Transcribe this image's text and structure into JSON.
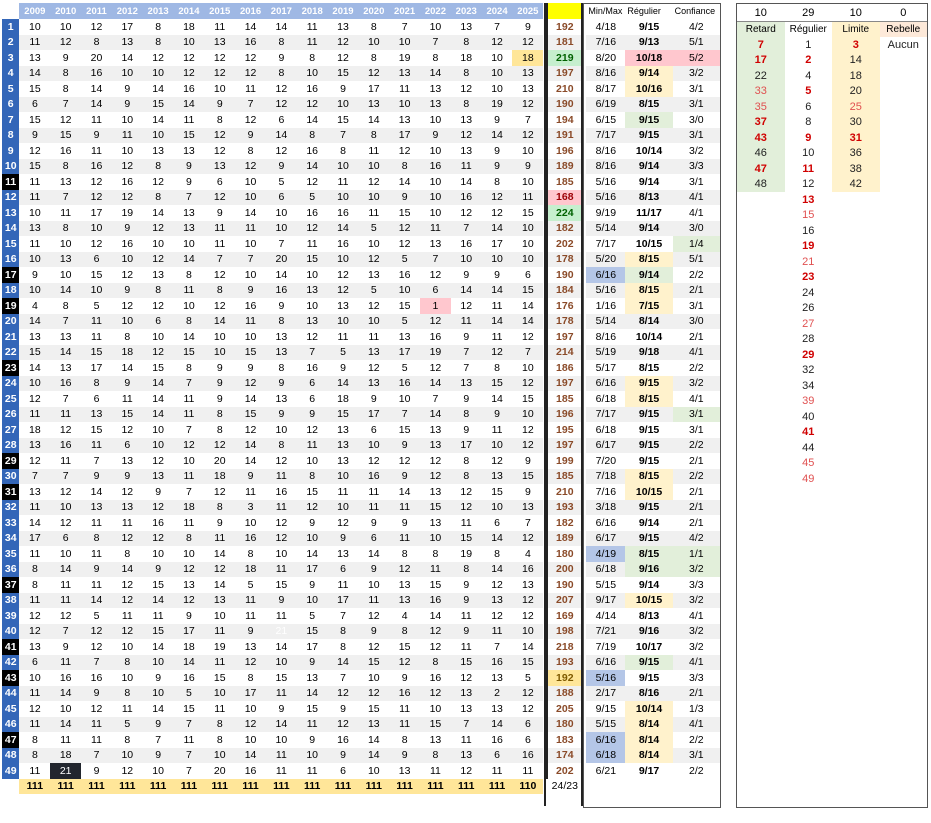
{
  "years": [
    "2009",
    "2010",
    "2011",
    "2012",
    "2013",
    "2014",
    "2015",
    "2016",
    "2017",
    "2018",
    "2019",
    "2020",
    "2021",
    "2022",
    "2023",
    "2024",
    "2025"
  ],
  "headers": {
    "minmax": "Min/Max",
    "regulier": "Régulier",
    "confiance": "Confiance"
  },
  "rows": [
    {
      "n": 1,
      "v": [
        10,
        10,
        12,
        17,
        8,
        18,
        11,
        14,
        14,
        11,
        13,
        8,
        7,
        10,
        13,
        7,
        9
      ],
      "total": 192,
      "minmax": "4/18",
      "reg": "9/15",
      "conf": "4/2"
    },
    {
      "n": 2,
      "v": [
        11,
        12,
        8,
        13,
        8,
        10,
        13,
        16,
        8,
        11,
        12,
        10,
        10,
        7,
        8,
        12,
        12
      ],
      "total": 181,
      "minmax": "7/16",
      "reg": "9/13",
      "conf": "5/1"
    },
    {
      "n": 3,
      "v": [
        13,
        9,
        20,
        14,
        12,
        12,
        12,
        12,
        9,
        8,
        12,
        8,
        19,
        8,
        18,
        10,
        18
      ],
      "total": 219,
      "minmax": "8/20",
      "reg": "10/18",
      "conf": "5/2"
    },
    {
      "n": 4,
      "v": [
        14,
        8,
        16,
        10,
        10,
        12,
        12,
        12,
        8,
        10,
        15,
        12,
        13,
        14,
        8,
        10,
        13
      ],
      "total": 197,
      "minmax": "8/16",
      "reg": "9/14",
      "conf": "3/2"
    },
    {
      "n": 5,
      "v": [
        15,
        8,
        14,
        9,
        14,
        16,
        10,
        11,
        12,
        16,
        9,
        17,
        11,
        13,
        12,
        10,
        13
      ],
      "total": 210,
      "minmax": "8/17",
      "reg": "10/16",
      "conf": "3/1"
    },
    {
      "n": 6,
      "v": [
        6,
        7,
        14,
        9,
        15,
        14,
        9,
        7,
        12,
        12,
        10,
        13,
        10,
        13,
        8,
        19,
        12
      ],
      "total": 190,
      "minmax": "6/19",
      "reg": "8/15",
      "conf": "3/1"
    },
    {
      "n": 7,
      "v": [
        15,
        12,
        11,
        10,
        14,
        11,
        8,
        12,
        6,
        14,
        15,
        14,
        13,
        10,
        13,
        9,
        7
      ],
      "total": 194,
      "minmax": "6/15",
      "reg": "9/15",
      "conf": "3/0"
    },
    {
      "n": 8,
      "v": [
        9,
        15,
        9,
        11,
        10,
        15,
        12,
        9,
        14,
        8,
        7,
        8,
        17,
        9,
        12,
        14,
        12
      ],
      "total": 191,
      "minmax": "7/17",
      "reg": "9/15",
      "conf": "3/1"
    },
    {
      "n": 9,
      "v": [
        12,
        16,
        11,
        10,
        13,
        13,
        12,
        8,
        12,
        16,
        8,
        11,
        12,
        10,
        13,
        9,
        10
      ],
      "total": 196,
      "minmax": "8/16",
      "reg": "10/14",
      "conf": "3/2"
    },
    {
      "n": 10,
      "v": [
        15,
        8,
        16,
        12,
        8,
        9,
        13,
        12,
        9,
        14,
        10,
        10,
        8,
        16,
        11,
        9,
        9
      ],
      "total": 189,
      "minmax": "8/16",
      "reg": "9/14",
      "conf": "3/3"
    },
    {
      "n": 11,
      "v": [
        11,
        13,
        12,
        16,
        12,
        9,
        6,
        10,
        5,
        12,
        11,
        12,
        14,
        10,
        14,
        8,
        10
      ],
      "total": 185,
      "minmax": "5/16",
      "reg": "9/14",
      "conf": "3/1"
    },
    {
      "n": 12,
      "v": [
        11,
        7,
        12,
        12,
        8,
        7,
        12,
        10,
        6,
        5,
        10,
        10,
        9,
        10,
        16,
        12,
        11
      ],
      "total": 168,
      "minmax": "5/16",
      "reg": "8/13",
      "conf": "4/1"
    },
    {
      "n": 13,
      "v": [
        10,
        11,
        17,
        19,
        14,
        13,
        9,
        14,
        10,
        16,
        16,
        11,
        15,
        10,
        12,
        12,
        15
      ],
      "total": 224,
      "minmax": "9/19",
      "reg": "11/17",
      "conf": "4/1"
    },
    {
      "n": 14,
      "v": [
        13,
        8,
        10,
        9,
        12,
        13,
        11,
        11,
        10,
        12,
        14,
        5,
        12,
        11,
        7,
        14,
        10
      ],
      "total": 182,
      "minmax": "5/14",
      "reg": "9/14",
      "conf": "3/0"
    },
    {
      "n": 15,
      "v": [
        11,
        10,
        12,
        16,
        10,
        10,
        11,
        10,
        7,
        11,
        16,
        10,
        12,
        13,
        16,
        17,
        10
      ],
      "total": 202,
      "minmax": "7/17",
      "reg": "10/15",
      "conf": "1/4"
    },
    {
      "n": 16,
      "v": [
        10,
        13,
        6,
        10,
        12,
        14,
        7,
        7,
        20,
        15,
        10,
        12,
        5,
        7,
        10,
        10,
        10
      ],
      "total": 178,
      "minmax": "5/20",
      "reg": "8/15",
      "conf": "5/1"
    },
    {
      "n": 17,
      "v": [
        9,
        10,
        15,
        12,
        13,
        8,
        12,
        10,
        14,
        10,
        12,
        13,
        16,
        12,
        9,
        9,
        6
      ],
      "total": 190,
      "minmax": "6/16",
      "reg": "9/14",
      "conf": "2/2"
    },
    {
      "n": 18,
      "v": [
        10,
        14,
        10,
        9,
        8,
        11,
        8,
        9,
        16,
        13,
        12,
        5,
        10,
        6,
        14,
        14,
        15
      ],
      "total": 184,
      "minmax": "5/16",
      "reg": "8/15",
      "conf": "2/1"
    },
    {
      "n": 19,
      "v": [
        4,
        8,
        5,
        12,
        12,
        10,
        12,
        16,
        9,
        10,
        13,
        12,
        15,
        1,
        12,
        11,
        14
      ],
      "total": 176,
      "minmax": "1/16",
      "reg": "7/15",
      "conf": "3/1"
    },
    {
      "n": 20,
      "v": [
        14,
        7,
        11,
        10,
        6,
        8,
        14,
        11,
        8,
        13,
        10,
        10,
        5,
        12,
        11,
        14,
        14
      ],
      "total": 178,
      "minmax": "5/14",
      "reg": "8/14",
      "conf": "3/0"
    },
    {
      "n": 21,
      "v": [
        13,
        13,
        11,
        8,
        10,
        14,
        10,
        10,
        13,
        12,
        11,
        11,
        13,
        16,
        9,
        11,
        12
      ],
      "total": 197,
      "minmax": "8/16",
      "reg": "10/14",
      "conf": "2/1"
    },
    {
      "n": 22,
      "v": [
        15,
        14,
        15,
        18,
        12,
        15,
        10,
        15,
        13,
        7,
        5,
        13,
        17,
        19,
        7,
        12,
        7
      ],
      "total": 214,
      "minmax": "5/19",
      "reg": "9/18",
      "conf": "4/1"
    },
    {
      "n": 23,
      "v": [
        14,
        13,
        17,
        14,
        15,
        8,
        9,
        9,
        8,
        16,
        9,
        12,
        5,
        12,
        7,
        8,
        10
      ],
      "total": 186,
      "minmax": "5/17",
      "reg": "8/15",
      "conf": "2/2"
    },
    {
      "n": 24,
      "v": [
        10,
        16,
        8,
        9,
        14,
        7,
        9,
        12,
        9,
        6,
        14,
        13,
        16,
        14,
        13,
        15,
        12
      ],
      "total": 197,
      "minmax": "6/16",
      "reg": "9/15",
      "conf": "3/2"
    },
    {
      "n": 25,
      "v": [
        12,
        7,
        6,
        11,
        14,
        11,
        9,
        14,
        13,
        6,
        18,
        9,
        10,
        7,
        9,
        14,
        15
      ],
      "total": 185,
      "minmax": "6/18",
      "reg": "8/15",
      "conf": "4/1"
    },
    {
      "n": 26,
      "v": [
        11,
        11,
        13,
        15,
        14,
        11,
        8,
        15,
        9,
        9,
        15,
        17,
        7,
        14,
        8,
        9,
        10
      ],
      "total": 196,
      "minmax": "7/17",
      "reg": "9/15",
      "conf": "3/1"
    },
    {
      "n": 27,
      "v": [
        18,
        12,
        15,
        12,
        10,
        7,
        8,
        12,
        10,
        12,
        13,
        6,
        15,
        13,
        9,
        11,
        12
      ],
      "total": 195,
      "minmax": "6/18",
      "reg": "9/15",
      "conf": "3/1"
    },
    {
      "n": 28,
      "v": [
        13,
        16,
        11,
        6,
        10,
        12,
        12,
        14,
        8,
        11,
        13,
        10,
        9,
        13,
        17,
        10,
        12
      ],
      "total": 197,
      "minmax": "6/17",
      "reg": "9/15",
      "conf": "2/2"
    },
    {
      "n": 29,
      "v": [
        12,
        11,
        7,
        13,
        12,
        10,
        20,
        14,
        12,
        10,
        13,
        12,
        12,
        12,
        8,
        12,
        9
      ],
      "total": 199,
      "minmax": "7/20",
      "reg": "9/15",
      "conf": "2/1"
    },
    {
      "n": 30,
      "v": [
        7,
        7,
        9,
        9,
        13,
        11,
        18,
        9,
        11,
        8,
        10,
        16,
        9,
        12,
        8,
        13,
        15
      ],
      "total": 185,
      "minmax": "7/18",
      "reg": "8/15",
      "conf": "2/2"
    },
    {
      "n": 31,
      "v": [
        13,
        12,
        14,
        12,
        9,
        7,
        12,
        11,
        16,
        15,
        11,
        11,
        14,
        13,
        12,
        15,
        9
      ],
      "total": 210,
      "minmax": "7/16",
      "reg": "10/15",
      "conf": "2/1"
    },
    {
      "n": 32,
      "v": [
        11,
        10,
        13,
        13,
        12,
        18,
        8,
        3,
        11,
        12,
        10,
        11,
        11,
        15,
        12,
        10,
        13
      ],
      "total": 193,
      "minmax": "3/18",
      "reg": "9/15",
      "conf": "2/1"
    },
    {
      "n": 33,
      "v": [
        14,
        12,
        11,
        11,
        16,
        11,
        9,
        10,
        12,
        9,
        12,
        9,
        9,
        13,
        11,
        6,
        7
      ],
      "total": 182,
      "minmax": "6/16",
      "reg": "9/14",
      "conf": "2/1"
    },
    {
      "n": 34,
      "v": [
        17,
        6,
        8,
        12,
        12,
        8,
        11,
        16,
        12,
        10,
        9,
        6,
        11,
        10,
        15,
        14,
        12
      ],
      "total": 189,
      "minmax": "6/17",
      "reg": "9/15",
      "conf": "4/2"
    },
    {
      "n": 35,
      "v": [
        11,
        10,
        11,
        8,
        10,
        10,
        14,
        8,
        10,
        14,
        13,
        14,
        8,
        8,
        19,
        8,
        4
      ],
      "total": 180,
      "minmax": "4/19",
      "reg": "8/15",
      "conf": "1/1"
    },
    {
      "n": 36,
      "v": [
        8,
        14,
        9,
        14,
        9,
        12,
        12,
        18,
        11,
        17,
        6,
        9,
        12,
        11,
        8,
        14,
        16
      ],
      "total": 200,
      "minmax": "6/18",
      "reg": "9/16",
      "conf": "3/2"
    },
    {
      "n": 37,
      "v": [
        8,
        11,
        11,
        12,
        15,
        13,
        14,
        5,
        15,
        9,
        11,
        10,
        13,
        15,
        9,
        12,
        13
      ],
      "total": 190,
      "minmax": "5/15",
      "reg": "9/14",
      "conf": "3/3"
    },
    {
      "n": 38,
      "v": [
        11,
        11,
        14,
        12,
        14,
        12,
        13,
        11,
        9,
        10,
        17,
        11,
        13,
        16,
        9,
        13,
        12
      ],
      "total": 207,
      "minmax": "9/17",
      "reg": "10/15",
      "conf": "3/2"
    },
    {
      "n": 39,
      "v": [
        12,
        12,
        5,
        11,
        11,
        9,
        10,
        11,
        11,
        5,
        7,
        12,
        4,
        14,
        11,
        12,
        12
      ],
      "total": 169,
      "minmax": "4/14",
      "reg": "8/13",
      "conf": "4/1"
    },
    {
      "n": 40,
      "v": [
        12,
        7,
        12,
        12,
        15,
        17,
        11,
        9,
        21,
        15,
        8,
        9,
        8,
        12,
        9,
        11,
        10
      ],
      "total": 198,
      "minmax": "7/21",
      "reg": "9/16",
      "conf": "3/2"
    },
    {
      "n": 41,
      "v": [
        13,
        9,
        12,
        10,
        14,
        18,
        19,
        13,
        14,
        17,
        8,
        12,
        15,
        12,
        11,
        7,
        14
      ],
      "total": 218,
      "minmax": "7/19",
      "reg": "10/17",
      "conf": "3/2"
    },
    {
      "n": 42,
      "v": [
        6,
        11,
        7,
        8,
        10,
        14,
        11,
        12,
        10,
        9,
        14,
        15,
        12,
        8,
        15,
        16,
        15
      ],
      "total": 193,
      "minmax": "6/16",
      "reg": "9/15",
      "conf": "4/1"
    },
    {
      "n": 43,
      "v": [
        10,
        16,
        16,
        10,
        9,
        16,
        15,
        8,
        15,
        13,
        7,
        10,
        9,
        16,
        12,
        13,
        5
      ],
      "total": 192,
      "minmax": "5/16",
      "reg": "9/15",
      "conf": "3/3"
    },
    {
      "n": 44,
      "v": [
        11,
        14,
        9,
        8,
        10,
        5,
        10,
        17,
        11,
        14,
        12,
        12,
        16,
        12,
        13,
        2,
        12
      ],
      "total": 188,
      "minmax": "2/17",
      "reg": "8/16",
      "conf": "2/1"
    },
    {
      "n": 45,
      "v": [
        12,
        10,
        12,
        11,
        14,
        15,
        11,
        10,
        9,
        15,
        9,
        15,
        11,
        10,
        13,
        13,
        12
      ],
      "total": 205,
      "minmax": "9/15",
      "reg": "10/14",
      "conf": "1/3"
    },
    {
      "n": 46,
      "v": [
        11,
        14,
        11,
        5,
        9,
        7,
        8,
        12,
        14,
        11,
        12,
        13,
        11,
        15,
        7,
        14,
        6
      ],
      "total": 180,
      "minmax": "5/15",
      "reg": "8/14",
      "conf": "4/1"
    },
    {
      "n": 47,
      "v": [
        8,
        11,
        11,
        8,
        7,
        11,
        8,
        10,
        10,
        9,
        16,
        14,
        8,
        13,
        11,
        16,
        6
      ],
      "total": 183,
      "minmax": "6/16",
      "reg": "8/14",
      "conf": "2/2"
    },
    {
      "n": 48,
      "v": [
        8,
        18,
        7,
        10,
        9,
        7,
        10,
        14,
        11,
        10,
        9,
        14,
        9,
        8,
        13,
        6,
        16
      ],
      "total": 174,
      "minmax": "6/18",
      "reg": "8/14",
      "conf": "3/1"
    },
    {
      "n": 49,
      "v": [
        11,
        21,
        9,
        12,
        10,
        7,
        20,
        16,
        11,
        11,
        6,
        10,
        13,
        11,
        12,
        11,
        11
      ],
      "total": 202,
      "minmax": "6/21",
      "reg": "9/17",
      "conf": "2/2"
    }
  ],
  "footer": {
    "values": [
      "111",
      "111",
      "111",
      "111",
      "111",
      "111",
      "111",
      "111",
      "111",
      "111",
      "111",
      "111",
      "111",
      "111",
      "111",
      "111",
      "110"
    ],
    "ratio": "24/23"
  },
  "right_panel": {
    "counts": [
      "10",
      "29",
      "10",
      "0"
    ],
    "labels": [
      "Retard",
      "Régulier",
      "Limite",
      "Rebelle"
    ],
    "retard": [
      "7",
      "17",
      "22",
      "33",
      "35",
      "37",
      "43",
      "46",
      "47",
      "48"
    ],
    "regulier": [
      "1",
      "2",
      "4",
      "5",
      "6",
      "8",
      "9",
      "10",
      "11",
      "12",
      "13",
      "15",
      "16",
      "19",
      "21",
      "23",
      "24",
      "26",
      "27",
      "28",
      "29",
      "32",
      "34",
      "39",
      "40",
      "41",
      "44",
      "45",
      "49"
    ],
    "limite": [
      "3",
      "14",
      "18",
      "20",
      "25",
      "30",
      "31",
      "36",
      "38",
      "42"
    ],
    "rebelle": [
      "Aucun"
    ]
  },
  "colors": {
    "header_blue": "#9fb8e4",
    "row_blue": "#3366b8",
    "highlight_yellow": "#ffff00",
    "green": "#c6efce",
    "red": "#ffc7ce",
    "amber": "#ffe699"
  }
}
